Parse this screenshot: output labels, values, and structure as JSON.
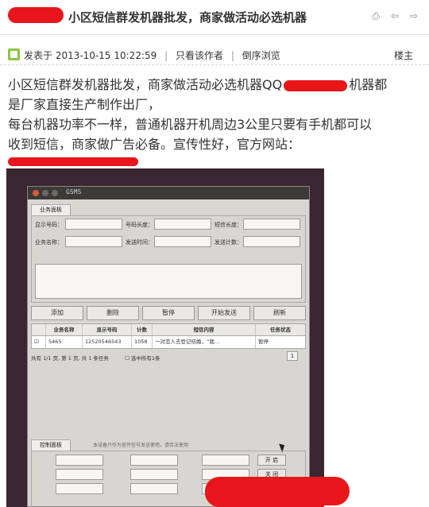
{
  "thread": {
    "title": "小区短信群发机器批发，商家做活动必选机器",
    "icons": [
      "print-icon",
      "prev-icon",
      "next-icon"
    ]
  },
  "meta": {
    "posted_label": "发表于 2013-10-15 10:22:59",
    "only_author": "只看该作者",
    "reverse_order": "倒序浏览",
    "floor": "楼主"
  },
  "post": {
    "line1a": "小区短信群发机器批发，商家做活动必选机器QQ",
    "line1b": "机器都",
    "line2": "是厂家直接生产制作出厂，",
    "line3": "每台机器功率不一样，普通机器开机周边3公里只要有手机都可以",
    "line4": "收到短信，商家做广告必备。宣传性好，官方网站："
  },
  "app": {
    "window_title": "GSMS",
    "task_panel_tab": "业务面板",
    "fields": {
      "display_number": "显示号码：",
      "number_length": "号码长度：",
      "content_length": "短信长度：",
      "task_name": "业务名称：",
      "send_time": "发送时间：",
      "send_count": "发送计数："
    },
    "buttons": {
      "add": "添加",
      "delete": "删除",
      "pause": "暂停",
      "start_send": "开始发送",
      "refresh": "刷新"
    },
    "table": {
      "headers": [
        "业务名称",
        "显示号码",
        "计数",
        "短信内容",
        "任务状态"
      ],
      "rows": [
        [
          "5465",
          "12520546543",
          "1058",
          "一对恋人去登记结婚，“我…",
          "暂停"
        ]
      ]
    },
    "footer": {
      "status": "共有 1/1 页, 第 1 页, 共 1 条任务",
      "select_all": "选中所有1条",
      "page": "1"
    },
    "control_tab": "控制面板",
    "control_note": "本设备只作为宣传信号发送使用，请合法使用",
    "control_buttons": {
      "start": "开 启",
      "close": "关 闭"
    }
  }
}
